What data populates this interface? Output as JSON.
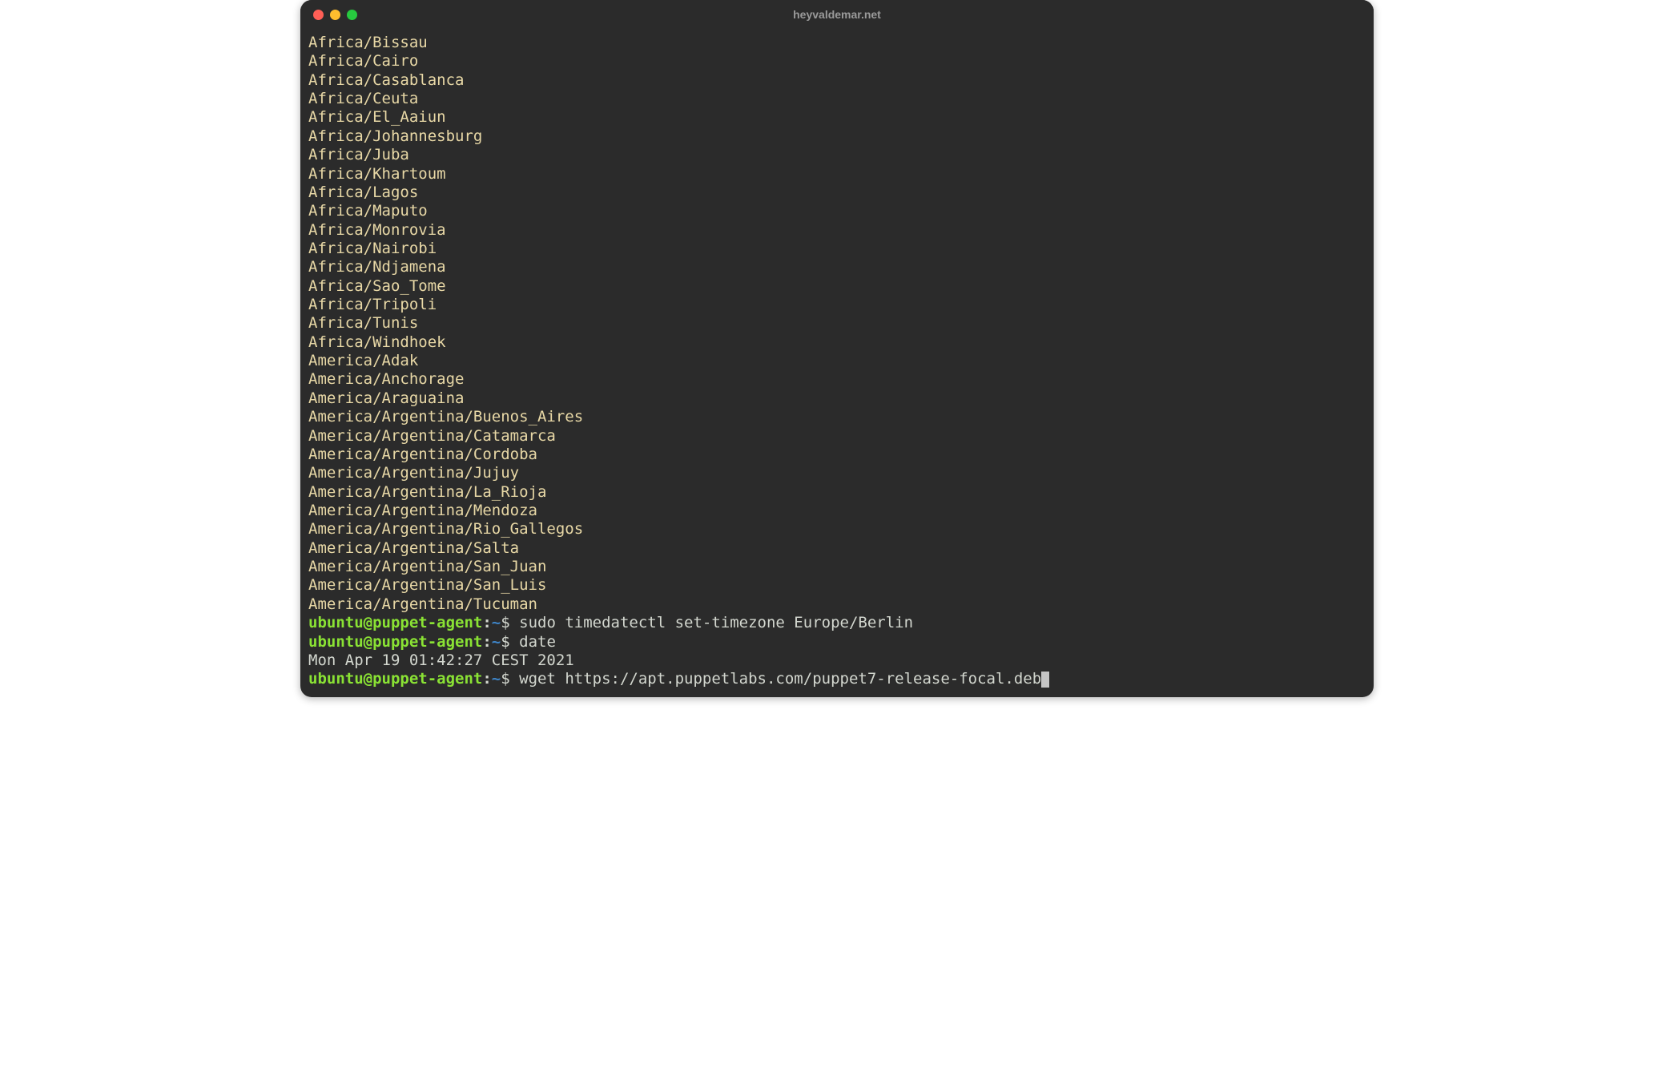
{
  "window": {
    "title": "heyvaldemar.net"
  },
  "output_lines": [
    "Africa/Bissau",
    "Africa/Cairo",
    "Africa/Casablanca",
    "Africa/Ceuta",
    "Africa/El_Aaiun",
    "Africa/Johannesburg",
    "Africa/Juba",
    "Africa/Khartoum",
    "Africa/Lagos",
    "Africa/Maputo",
    "Africa/Monrovia",
    "Africa/Nairobi",
    "Africa/Ndjamena",
    "Africa/Sao_Tome",
    "Africa/Tripoli",
    "Africa/Tunis",
    "Africa/Windhoek",
    "America/Adak",
    "America/Anchorage",
    "America/Araguaina",
    "America/Argentina/Buenos_Aires",
    "America/Argentina/Catamarca",
    "America/Argentina/Cordoba",
    "America/Argentina/Jujuy",
    "America/Argentina/La_Rioja",
    "America/Argentina/Mendoza",
    "America/Argentina/Rio_Gallegos",
    "America/Argentina/Salta",
    "America/Argentina/San_Juan",
    "America/Argentina/San_Luis",
    "America/Argentina/Tucuman"
  ],
  "prompts": [
    {
      "user": "ubuntu@puppet-agent",
      "colon": ":",
      "path": "~",
      "dollar": "$ ",
      "command": "sudo timedatectl set-timezone Europe/Berlin",
      "cursor": false
    },
    {
      "user": "ubuntu@puppet-agent",
      "colon": ":",
      "path": "~",
      "dollar": "$ ",
      "command": "date",
      "cursor": false
    }
  ],
  "date_output": "Mon Apr 19 01:42:27 CEST 2021",
  "final_prompt": {
    "user": "ubuntu@puppet-agent",
    "colon": ":",
    "path": "~",
    "dollar": "$ ",
    "command": "wget https://apt.puppetlabs.com/puppet7-release-focal.deb",
    "cursor": true
  }
}
